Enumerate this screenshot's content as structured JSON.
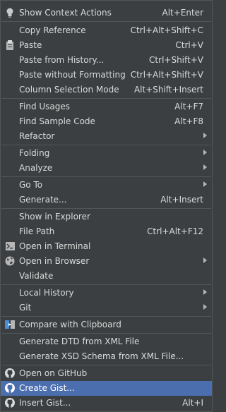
{
  "menu": {
    "items": [
      {
        "label": "Show Context Actions",
        "shortcut": "Alt+Enter"
      },
      {
        "label": "Copy Reference",
        "shortcut": "Ctrl+Alt+Shift+C"
      },
      {
        "label": "Paste",
        "shortcut": "Ctrl+V"
      },
      {
        "label": "Paste from History...",
        "shortcut": "Ctrl+Shift+V"
      },
      {
        "label": "Paste without Formatting",
        "shortcut": "Ctrl+Alt+Shift+V"
      },
      {
        "label": "Column Selection Mode",
        "shortcut": "Alt+Shift+Insert"
      },
      {
        "label": "Find Usages",
        "shortcut": "Alt+F7"
      },
      {
        "label": "Find Sample Code",
        "shortcut": "Alt+F8"
      },
      {
        "label": "Refactor"
      },
      {
        "label": "Folding"
      },
      {
        "label": "Analyze"
      },
      {
        "label": "Go To"
      },
      {
        "label": "Generate...",
        "shortcut": "Alt+Insert"
      },
      {
        "label": "Show in Explorer"
      },
      {
        "label": "File Path",
        "shortcut": "Ctrl+Alt+F12"
      },
      {
        "label": "Open in Terminal"
      },
      {
        "label": "Open in Browser"
      },
      {
        "label": "Validate"
      },
      {
        "label": "Local History"
      },
      {
        "label": "Git"
      },
      {
        "label": "Compare with Clipboard"
      },
      {
        "label": "Generate DTD from XML File"
      },
      {
        "label": "Generate XSD Schema from XML File..."
      },
      {
        "label": "Open on GitHub"
      },
      {
        "label": "Create Gist..."
      },
      {
        "label": "Insert Gist...",
        "shortcut": "Alt+I"
      }
    ]
  },
  "colors": {
    "background": "#3c3f41",
    "highlight": "#4b6eaf",
    "text": "#dadada",
    "separator": "#515658"
  }
}
